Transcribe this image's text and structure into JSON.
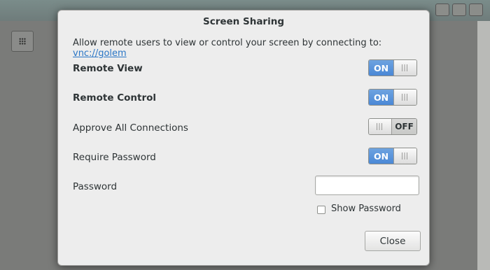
{
  "dialog": {
    "title": "Screen Sharing",
    "intro_text": "Allow remote users to view or control your screen by connecting to:",
    "intro_link": "vnc://golem",
    "remote_view_label": "Remote View",
    "remote_view_state": "ON",
    "remote_control_label": "Remote Control",
    "remote_control_state": "ON",
    "approve_label": "Approve All Connections",
    "approve_state": "OFF",
    "require_password_label": "Require Password",
    "require_password_state": "ON",
    "password_label": "Password",
    "password_value": "",
    "show_password_label": "Show Password",
    "close_label": "Close"
  },
  "colors": {
    "switch_on": "#4a88d6",
    "link": "#2a76c6"
  }
}
